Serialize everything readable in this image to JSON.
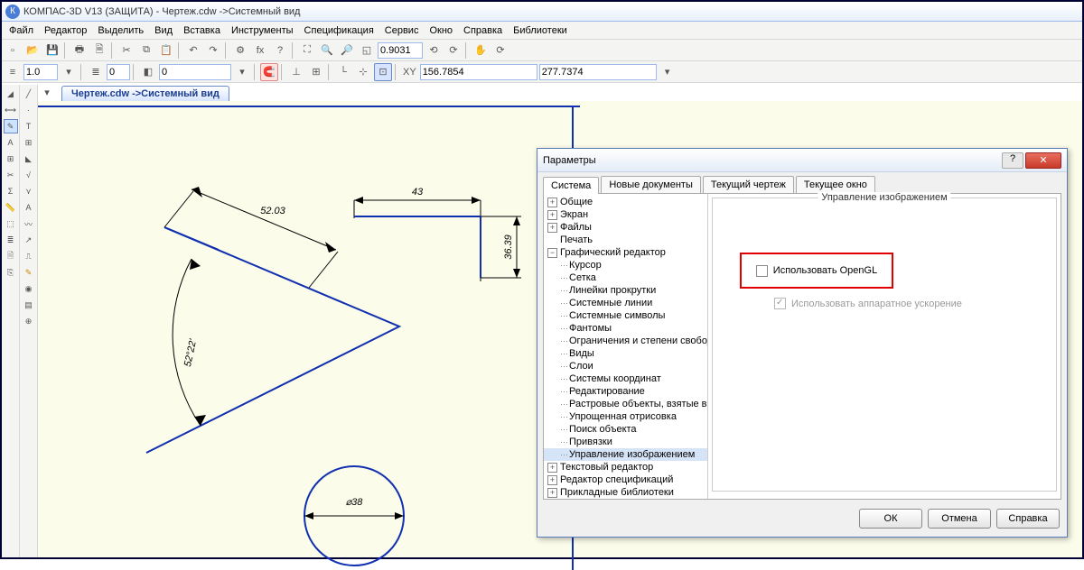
{
  "title": "КОМПАС-3D V13 (ЗАЩИТА) - Чертеж.cdw ->Системный вид",
  "menu": [
    "Файл",
    "Редактор",
    "Выделить",
    "Вид",
    "Вставка",
    "Инструменты",
    "Спецификация",
    "Сервис",
    "Окно",
    "Справка",
    "Библиотеки"
  ],
  "tab_label": "Чертеж.cdw ->Системный вид",
  "zoom_value": "0.9031",
  "style_value": "1.0",
  "layer_value": "0",
  "layer2_value": "0",
  "coord_x": "156.7854",
  "coord_y": "277.7374",
  "coord_label": "XY",
  "drawing": {
    "dim1": "52.03",
    "dim2": "43",
    "dim3": "36.39",
    "angle": "52°22'",
    "diameter": "⌀38"
  },
  "dialog": {
    "title": "Параметры",
    "tabs": [
      "Система",
      "Новые документы",
      "Текущий чертеж",
      "Текущее окно"
    ],
    "tree": {
      "t0": "Общие",
      "t1": "Экран",
      "t2": "Файлы",
      "t3": "Печать",
      "t4": "Графический редактор",
      "t4c": [
        "Курсор",
        "Сетка",
        "Линейки прокрутки",
        "Системные линии",
        "Системные символы",
        "Фантомы",
        "Ограничения и степени свободы",
        "Виды",
        "Слои",
        "Системы координат",
        "Редактирование",
        "Растровые объекты, взятые в документ",
        "Упрощенная отрисовка",
        "Поиск объекта",
        "Привязки",
        "Управление изображением"
      ],
      "t5": "Текстовый редактор",
      "t6": "Редактор спецификаций",
      "t7": "Прикладные библиотеки"
    },
    "group_title": "Управление изображением",
    "cb1": "Использовать OpenGL",
    "cb2": "Использовать аппаратное ускорение",
    "buttons": [
      "ОК",
      "Отмена",
      "Справка"
    ]
  }
}
